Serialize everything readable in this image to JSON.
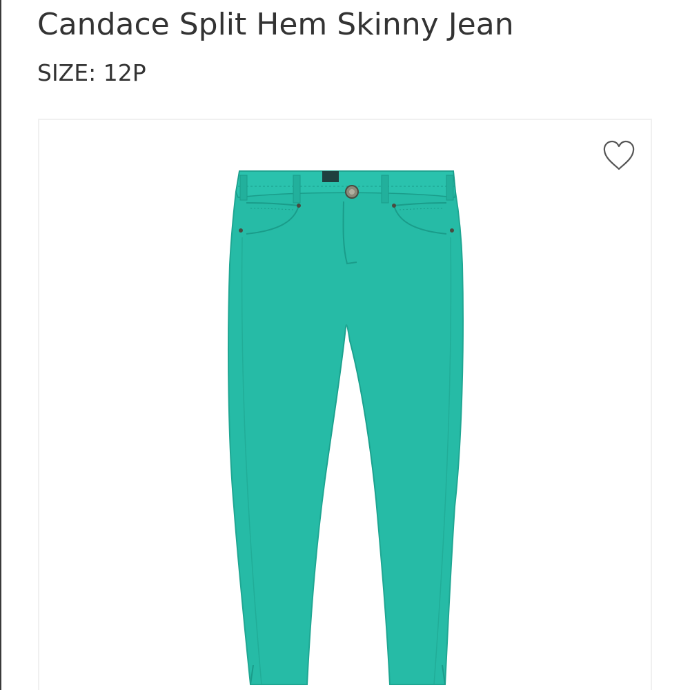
{
  "product": {
    "title": "Candace Split Hem Skinny Jean",
    "size_text": "SIZE: 12P",
    "image_icon": "skinny-jeans-image",
    "garment_color": "#26bba6"
  },
  "favorite": {
    "icon": "heart-outline-icon",
    "aria_label": "Favorite"
  },
  "colors": {
    "text": "#333333",
    "card_border": "#f0f0f0",
    "icon_stroke": "#555555"
  }
}
